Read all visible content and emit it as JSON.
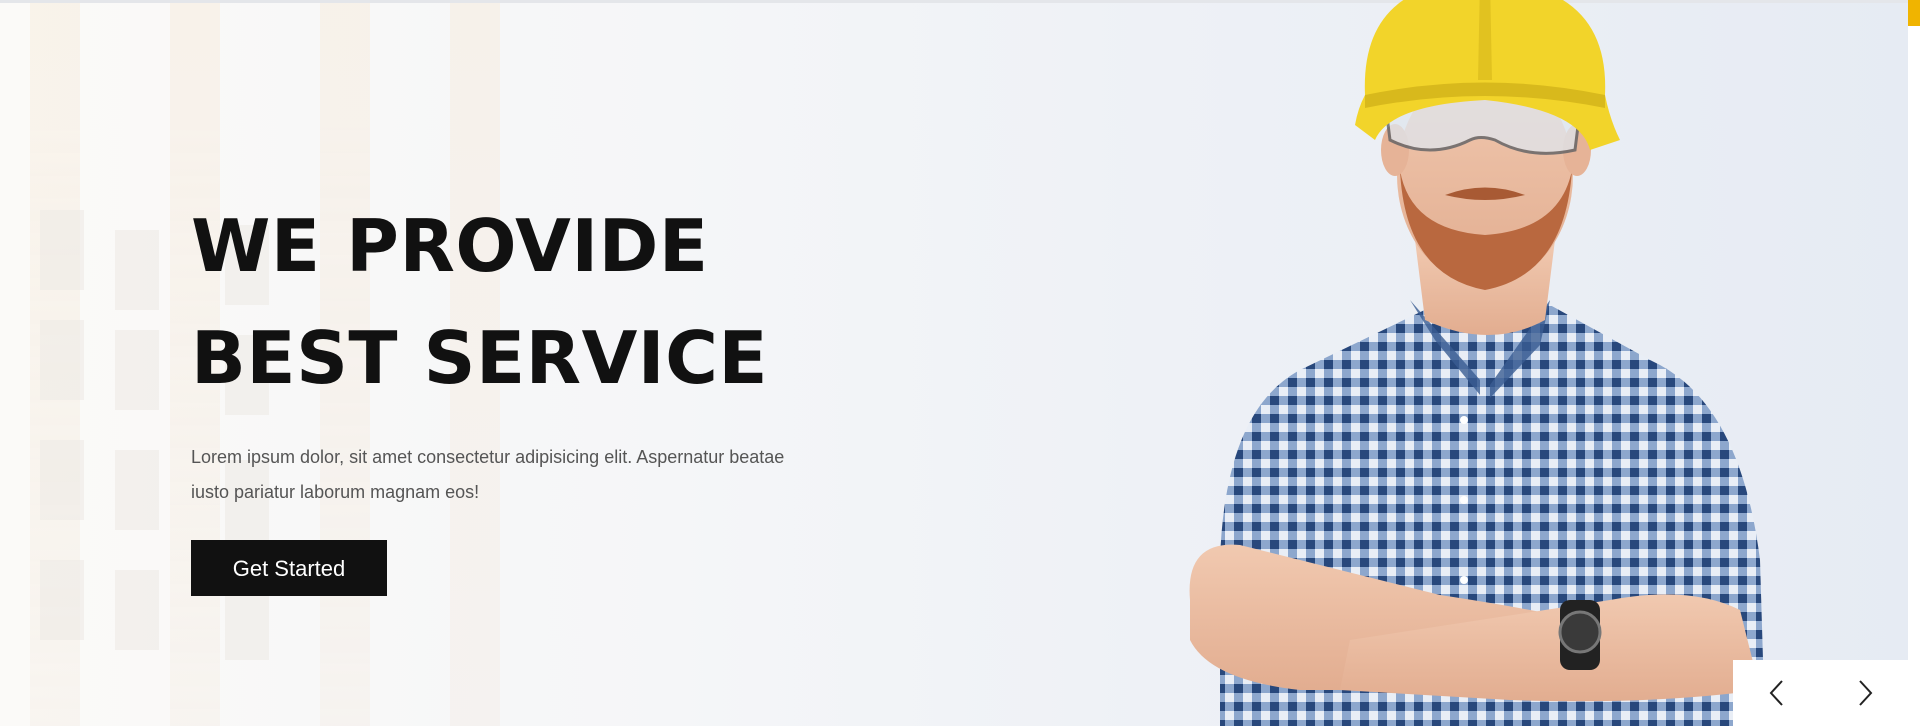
{
  "hero": {
    "heading_line1": "WE PROVIDE",
    "heading_line2": "BEST SERVICE",
    "description": "Lorem ipsum dolor, sit amet consectetur adipisicing elit. Aspernatur beatae iusto pariatur laborum magnam eos!",
    "cta_label": "Get Started"
  },
  "slider": {
    "prev_icon": "chevron-left-icon",
    "next_icon": "chevron-right-icon"
  },
  "colors": {
    "accent": "#f0b400",
    "heading": "#111111",
    "text": "#555555",
    "button_bg": "#111111",
    "button_text": "#ffffff",
    "helmet": "#f2d42a",
    "shirt": "#3a5d92"
  }
}
